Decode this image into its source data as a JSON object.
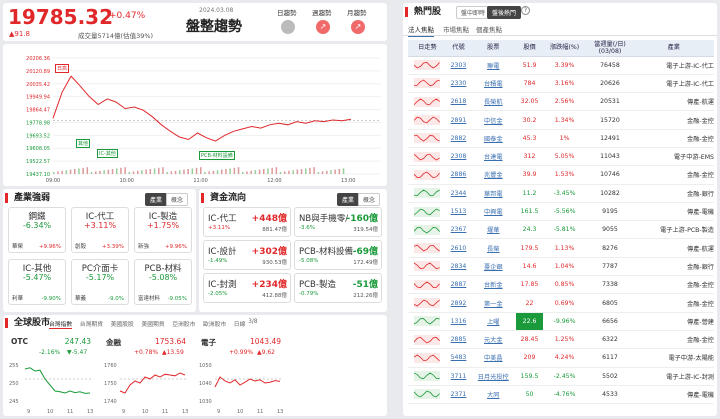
{
  "header": {
    "index_value": "19785.32",
    "change_pct": "+0.47%",
    "change_pts": "▲91.8",
    "volume": "成交量5714億(估值39%)",
    "date": "2024.03.08",
    "title": "盤整趨勢",
    "trend_labels": [
      "日趨勢",
      "週趨勢",
      "月趨勢"
    ]
  },
  "intraday": {
    "y_ticks": [
      "20206.36",
      "20120.89",
      "20035.42",
      "19949.94",
      "19864.47",
      "19778.98",
      "19693.52",
      "19608.05",
      "19522.57",
      "19437.10"
    ],
    "x_ticks": [
      "09:00",
      "10:00",
      "11:00",
      "12:00",
      "13:00"
    ],
    "annotations": [
      "日高",
      "其他",
      "IC-其他",
      "PCB-材料設備"
    ]
  },
  "industry": {
    "title": "產業強弱",
    "tabs": [
      "產業",
      "概念"
    ],
    "cards": [
      {
        "name": "鋼鐵",
        "pct": "-6.34%",
        "sub": "華榮",
        "subpct": "+9.96%"
      },
      {
        "name": "IC-代工",
        "pct": "+3.11%",
        "sub": "創毅",
        "subpct": "+3.39%"
      },
      {
        "name": "IC-製造",
        "pct": "+1.75%",
        "sub": "新強",
        "subpct": "+9.96%"
      },
      {
        "name": "IC-其他",
        "pct": "-5.47%",
        "sub": "利華",
        "subpct": "-9.90%"
      },
      {
        "name": "PC介面卡",
        "pct": "-5.17%",
        "sub": "華義",
        "subpct": "-9.0%"
      },
      {
        "name": "PCB-材料",
        "pct": "-5.08%",
        "sub": "富達材料",
        "subpct": "-9.05%"
      }
    ]
  },
  "flow": {
    "title": "資金流向",
    "tabs": [
      "產業",
      "概念"
    ],
    "cards": [
      {
        "name": "IC-代工",
        "val": "+448億",
        "pct": "+3.11%",
        "vol": "881.47億"
      },
      {
        "name": "NB與手機零/",
        "val": "-160億",
        "pct": "-3.6%",
        "vol": "319.54億"
      },
      {
        "name": "IC-設計",
        "val": "+302億",
        "pct": "-1.49%",
        "vol": "930.53億"
      },
      {
        "name": "PCB-材料設備",
        "val": "-69億",
        "pct": "-5.08%",
        "vol": "172.49億"
      },
      {
        "name": "IC-封測",
        "val": "+234億",
        "pct": "-2.05%",
        "vol": "412.88億"
      },
      {
        "name": "PCB-製造",
        "val": "-51億",
        "pct": "-0.79%",
        "vol": "212.26億"
      }
    ]
  },
  "global": {
    "title": "全球股市",
    "tabs": [
      "台灣指數",
      "台灣期貨",
      "美國股股",
      "美國期貨",
      "亞洲股市",
      "歐洲股市",
      "日線"
    ],
    "page": "3/8",
    "minis": [
      {
        "name": "OTC",
        "value": "247.43",
        "pct": "-2.16%",
        "pts": "▼-5.47",
        "ticks": [
          "255",
          "250",
          "245"
        ],
        "x": [
          "9",
          "10",
          "11",
          "13"
        ]
      },
      {
        "name": "金融",
        "value": "1753.64",
        "pct": "+0.78%",
        "pts": "▲13.59",
        "ticks": [
          "1760",
          "1750",
          "1740"
        ],
        "x": [
          "9",
          "10",
          "11",
          "13"
        ]
      },
      {
        "name": "電子",
        "value": "1043.49",
        "pct": "+0.99%",
        "pts": "▲9.62",
        "ticks": [
          "1050",
          "1040",
          "1030"
        ],
        "x": [
          "9",
          "10",
          "11",
          "13"
        ]
      }
    ]
  },
  "hot": {
    "title": "熱門股",
    "tabs": [
      "盤中即時",
      "盤後熱門"
    ],
    "subtabs": [
      "法人焦點",
      "市場焦點",
      "個產焦點"
    ],
    "columns": [
      "日走勢",
      "代號",
      "股票",
      "股價",
      "漲跌幅(%)",
      "當週量(/日)\n(03/08)",
      "產業"
    ],
    "rows": [
      [
        "2303",
        "聯電",
        "51.9",
        "3.39%",
        "76458",
        "電子上游-IC-代工"
      ],
      [
        "2330",
        "台積電",
        "784",
        "3.16%",
        "20626",
        "電子上游-IC-代工"
      ],
      [
        "2618",
        "長榮航",
        "32.05",
        "2.56%",
        "20531",
        "傳產-航運"
      ],
      [
        "2891",
        "中信金",
        "30.2",
        "1.34%",
        "15720",
        "金融-金控"
      ],
      [
        "2882",
        "國泰金",
        "45.3",
        "1%",
        "12491",
        "金融-金控"
      ],
      [
        "2308",
        "台達電",
        "312",
        "5.05%",
        "11043",
        "電子中游-EMS"
      ],
      [
        "2886",
        "兆豐金",
        "39.9",
        "1.53%",
        "10746",
        "金融-金控"
      ],
      [
        "2344",
        "華邦電",
        "11.2",
        "-3.45%",
        "10282",
        "金融-銀行"
      ],
      [
        "1513",
        "中興電",
        "161.5",
        "-5.56%",
        "9195",
        "傳產-電機"
      ],
      [
        "2367",
        "燿華",
        "24.3",
        "-5.81%",
        "9055",
        "電子上游-PCB-製造"
      ],
      [
        "2610",
        "長榮",
        "179.5",
        "1.13%",
        "8276",
        "傳產-航運"
      ],
      [
        "2834",
        "臺企銀",
        "14.6",
        "1.04%",
        "7787",
        "金融-銀行"
      ],
      [
        "2887",
        "台新金",
        "17.85",
        "0.85%",
        "7338",
        "金融-金控"
      ],
      [
        "2892",
        "第一金",
        "22",
        "0.69%",
        "6805",
        "金融-金控"
      ],
      [
        "1316",
        "上曜",
        "22.6",
        "-9.96%",
        "6656",
        "傳產-營建"
      ],
      [
        "2885",
        "元大金",
        "28.45",
        "1.25%",
        "6322",
        "金融-金控"
      ],
      [
        "5483",
        "中美晶",
        "209",
        "4.24%",
        "6117",
        "電子中游-太陽能"
      ],
      [
        "3711",
        "日月光投控",
        "159.5",
        "-2.45%",
        "5502",
        "電子上游-IC-封測"
      ],
      [
        "2371",
        "大同",
        "50",
        "-4.76%",
        "4533",
        "傳產-電機"
      ]
    ]
  },
  "colors": {
    "up": "#e0282b",
    "down": "#1a9a3a",
    "accent": "#e0282b"
  }
}
